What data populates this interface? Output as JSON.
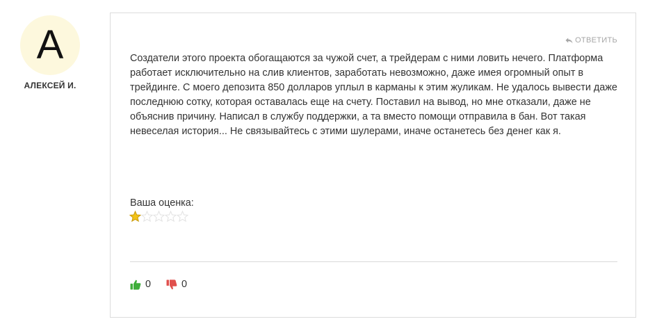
{
  "author": {
    "avatar_letter": "A",
    "name": "АЛЕКСЕЙ И."
  },
  "review": {
    "reply_label": "ОТВЕТИТЬ",
    "text": "Создатели этого проекта обогащаются за чужой счет, а трейдерам с ними ловить нечего. Платформа работает исключительно на слив клиентов, заработать невозможно, даже имея огромный опыт в трейдинге. С моего депозита 850 долларов уплыл в карманы к этим жуликам. Не удалось вывести даже последнюю сотку, которая оставалась еще на счету. Поставил на вывод, но мне отказали, даже не объяснив причину. Написал в службу поддержки, а та вместо помощи отправила в бан. Вот такая невеселая история... Не связывайтесь с этими шулерами, иначе останетесь без денег как я.",
    "rating_label": "Ваша оценка:",
    "rating": {
      "value": 1,
      "max": 5
    },
    "likes": "0",
    "dislikes": "0"
  },
  "colors": {
    "avatar_bg": "#fdf8dd",
    "star_filled": "#f2c318",
    "star_empty": "#e2e2e2",
    "like": "#3fae3a",
    "dislike": "#e0504d"
  },
  "icons": {
    "reply": "reply-arrow-icon",
    "like": "thumbs-up-icon",
    "dislike": "thumbs-down-icon",
    "star": "star-icon"
  }
}
